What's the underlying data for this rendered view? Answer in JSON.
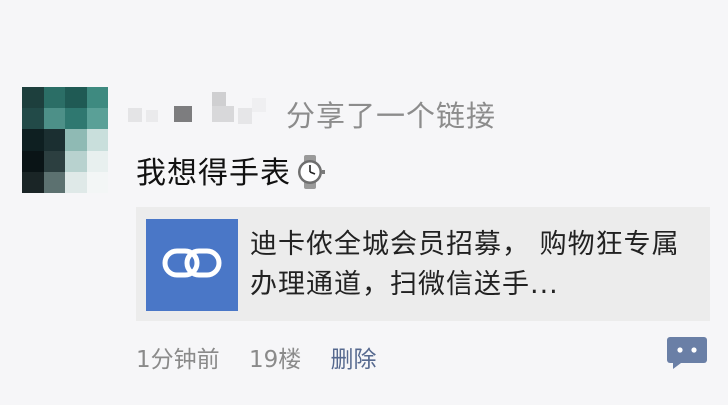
{
  "post": {
    "action_text": "分享了一个链接",
    "text": "我想得手表",
    "emoji_icon": "watch-icon",
    "link": {
      "title": "迪卡侬全城会员招募， 购物狂专属办理通道，扫微信送手...",
      "thumb_icon": "link-chain-icon",
      "thumb_color": "#4a77c7"
    },
    "meta": {
      "time": "1分钟前",
      "floor": "19楼",
      "delete_label": "删除"
    },
    "comment_icon": "comment-bubble-icon",
    "accent_color": "#56698f"
  }
}
